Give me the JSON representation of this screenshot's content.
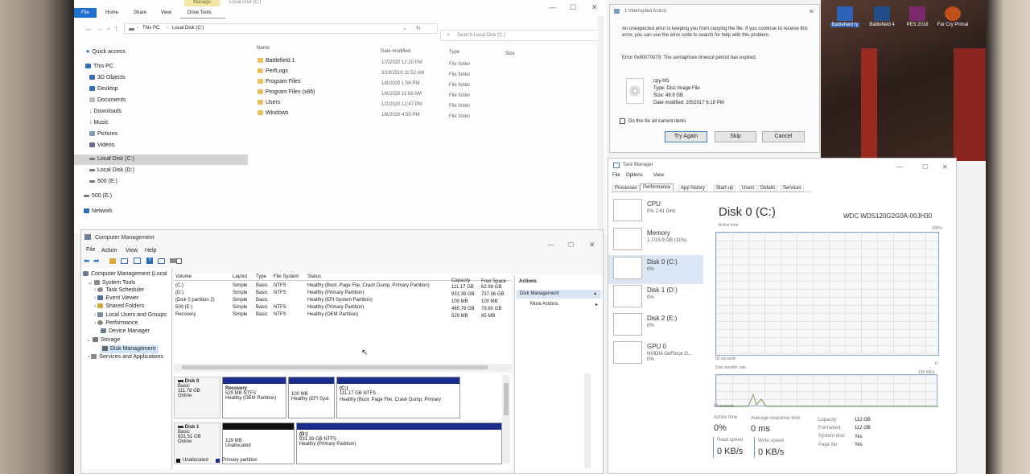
{
  "desktop": {
    "icons": [
      {
        "label": "Battlefield 4",
        "color": "#224b8a"
      },
      {
        "label": "PES 2018",
        "color": "#7a2a6b"
      },
      {
        "label": "Far Cry Primal",
        "color": "#c0501a"
      }
    ],
    "partial_label": "Battlefield ry"
  },
  "explorer": {
    "ribbon_tabs": [
      "File",
      "Home",
      "Share",
      "View",
      "Drive Tools"
    ],
    "manage_tab": "Manage",
    "title": "Local Disk (C:)",
    "breadcrumb": [
      "This PC",
      "Local Disk (C:)"
    ],
    "search_placeholder": "Search Local Disk (C:)",
    "columns": [
      "Name",
      "Date modified",
      "Type",
      "Size"
    ],
    "nav": [
      {
        "label": "Quick access",
        "icon": "star-icon"
      },
      {
        "label": "This PC",
        "icon": "pc-icon"
      },
      {
        "label": "3D Objects",
        "icon": "cube-icon"
      },
      {
        "label": "Desktop",
        "icon": "desktop-icon"
      },
      {
        "label": "Documents",
        "icon": "document-icon"
      },
      {
        "label": "Downloads",
        "icon": "download-icon"
      },
      {
        "label": "Music",
        "icon": "music-icon"
      },
      {
        "label": "Pictures",
        "icon": "picture-icon"
      },
      {
        "label": "Videos",
        "icon": "video-icon"
      },
      {
        "label": "Local Disk (C:)",
        "icon": "drive-icon"
      },
      {
        "label": "Local Disk (D:)",
        "icon": "drive-icon"
      },
      {
        "label": "500 (E:)",
        "icon": "drive-icon"
      },
      {
        "label": "500 (E:)",
        "icon": "drive-icon"
      },
      {
        "label": "Network",
        "icon": "network-icon"
      }
    ],
    "files": [
      {
        "name": "Battlefield 1",
        "date": "1/7/2020 12:20 PM",
        "type": "File folder"
      },
      {
        "name": "PerfLogs",
        "date": "3/19/2019 11:52 AM",
        "type": "File folder"
      },
      {
        "name": "Program Files",
        "date": "1/6/2020 1:56 PM",
        "type": "File folder"
      },
      {
        "name": "Program Files (x86)",
        "date": "1/6/2020 11:58 AM",
        "type": "File folder"
      },
      {
        "name": "Users",
        "date": "1/2/2020 12:47 PM",
        "type": "File folder"
      },
      {
        "name": "Windows",
        "date": "1/6/2020 4:55 PM",
        "type": "File folder"
      }
    ]
  },
  "interrupted": {
    "title": "1 Interrupted Action",
    "message": "An unexpected error is keeping you from copying the file. If you continue to receive this error, you can use the error code to search for help with this problem.",
    "error": "Error 0x80070079: The semaphore timeout period has expired.",
    "file": {
      "name": "cpy-hf1",
      "type": "Type: Disc Image File",
      "size": "Size: 49.9 GB",
      "modified": "Date modified: 2/5/2017 6:18 PM"
    },
    "checkbox_label": "Do this for all current items",
    "buttons": {
      "try_again": "Try Again",
      "skip": "Skip",
      "cancel": "Cancel"
    }
  },
  "task_manager": {
    "title": "Task Manager",
    "menu": [
      "File",
      "Options",
      "View"
    ],
    "tabs": [
      "Processes",
      "Performance",
      "App history",
      "Start-up",
      "Users",
      "Details",
      "Services"
    ],
    "tiles": [
      {
        "name": "CPU",
        "sub": "0% 2.41 GHz"
      },
      {
        "name": "Memory",
        "sub": "1.7/15.9 GB (11%)"
      },
      {
        "name": "Disk 0 (C:)",
        "sub": "0%"
      },
      {
        "name": "Disk 1 (D:)",
        "sub": "0%"
      },
      {
        "name": "Disk 2 (E:)",
        "sub": "0%"
      },
      {
        "name": "GPU 0",
        "sub": "NVIDIA GeForce G...",
        "sub2": "0%"
      }
    ],
    "detail_title": "Disk 0 (C:)",
    "model": "WDC WDS120G2G0A-00JH30",
    "active_time_label": "Active time",
    "pct_100": "100%",
    "sixty": "60 seconds",
    "zero": "0",
    "transfer_label": "Disk transfer rate",
    "transfer_max": "100 KB/s",
    "sixty2": "60 seconds",
    "stats": {
      "active_time_label": "Active time",
      "active_time": "0%",
      "avg_resp_label": "Average response time",
      "avg_resp": "0 ms",
      "read_label": "Read speed",
      "read": "0 KB/s",
      "write_label": "Write speed",
      "write": "0 KB/s"
    },
    "props": [
      {
        "k": "Capacity:",
        "v": "112 GB"
      },
      {
        "k": "Formatted:",
        "v": "112 GB"
      },
      {
        "k": "System disk:",
        "v": "Yes"
      },
      {
        "k": "Page file:",
        "v": "Yes"
      }
    ]
  },
  "disk_mgmt": {
    "title": "Computer Management",
    "menu": [
      "File",
      "Action",
      "View",
      "Help"
    ],
    "tree": [
      {
        "label": "Computer Management (Local",
        "indent": 0
      },
      {
        "label": "System Tools",
        "indent": 1
      },
      {
        "label": "Task Scheduler",
        "indent": 2
      },
      {
        "label": "Event Viewer",
        "indent": 2
      },
      {
        "label": "Shared Folders",
        "indent": 2
      },
      {
        "label": "Local Users and Groups",
        "indent": 2
      },
      {
        "label": "Performance",
        "indent": 2
      },
      {
        "label": "Device Manager",
        "indent": 2
      },
      {
        "label": "Storage",
        "indent": 1
      },
      {
        "label": "Disk Management",
        "indent": 2
      },
      {
        "label": "Services and Applications",
        "indent": 1
      }
    ],
    "columns": [
      "Volume",
      "Layout",
      "Type",
      "File System",
      "Status",
      "Capacity",
      "Free Space"
    ],
    "volumes": [
      {
        "v": "(C:)",
        "l": "Simple",
        "t": "Basic",
        "fs": "NTFS",
        "st": "Healthy (Boot, Page File, Crash Dump, Primary Partition)",
        "c": "111.17 GB",
        "f": "62.98 GB"
      },
      {
        "v": "(D:)",
        "l": "Simple",
        "t": "Basic",
        "fs": "NTFS",
        "st": "Healthy (Primary Partition)",
        "c": "931.39 GB",
        "f": "737.06 GB"
      },
      {
        "v": "(Disk 0 partition 2)",
        "l": "Simple",
        "t": "Basic",
        "fs": "",
        "st": "Healthy (EFI System Partition)",
        "c": "100 MB",
        "f": "100 MB"
      },
      {
        "v": "500 (E:)",
        "l": "Simple",
        "t": "Basic",
        "fs": "NTFS",
        "st": "Healthy (Primary Partition)",
        "c": "465.76 GB",
        "f": "79.80 GB"
      },
      {
        "v": "Recovery",
        "l": "Simple",
        "t": "Basic",
        "fs": "NTFS",
        "st": "Healthy (OEM Partition)",
        "c": "529 MB",
        "f": "85 MB"
      }
    ],
    "actions_header": "Actions",
    "actions_item": "Disk Management",
    "more_actions": "More Actions",
    "disks": [
      {
        "name": "Disk 0",
        "type": "Basic",
        "size": "111.78 GB",
        "status": "Online",
        "parts": [
          {
            "title": "Recovery",
            "l1": "529 MB NTFS",
            "l2": "Healthy (OEM Partition)"
          },
          {
            "title": "",
            "l1": "100 MB",
            "l2": "Healthy (EFI Syst"
          },
          {
            "title": "(C:)",
            "l1": "111.17 GB NTFS",
            "l2": "Healthy (Boot, Page File, Crash Dump, Primary"
          }
        ]
      },
      {
        "name": "Disk 1",
        "type": "Basic",
        "size": "931.51 GB",
        "status": "Online",
        "parts": [
          {
            "title": "",
            "l1": "129 MB",
            "l2": "Unallocated"
          },
          {
            "title": "(D:)",
            "l1": "931.39 GB NTFS",
            "l2": "Healthy (Primary Partition)"
          }
        ]
      }
    ],
    "legend": [
      "Unallocated",
      "Primary partition"
    ]
  }
}
